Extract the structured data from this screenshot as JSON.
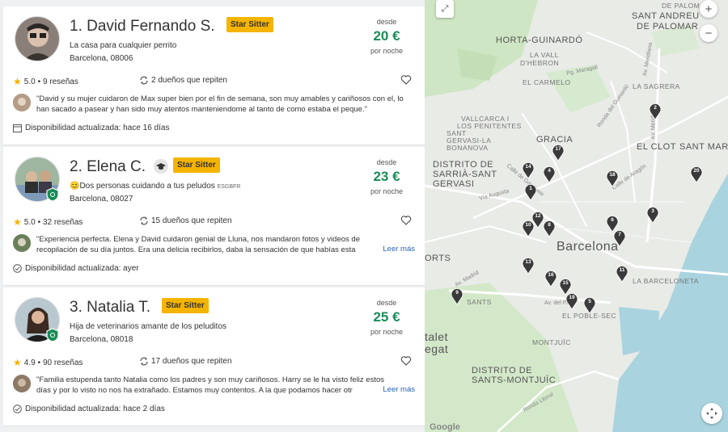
{
  "sitters": [
    {
      "name": "1. David Fernando S.",
      "badge": "Star Sitter",
      "tagline": "La casa para cualquier perrito",
      "address": "Barcelona, 08006",
      "desde": "desde",
      "price": "20 €",
      "per": "por noche",
      "rating": "5.0",
      "reviews": "• 9 reseñas",
      "repeat": "2 dueños que repiten",
      "review": "\"David y su mujer cuidaron de Max super bien por el fin de semana, son muy amables y cariñosos con el, lo han sacado a pasear y han sido muy atentos manteniendome al tanto de como estaba el peque.\"",
      "availability": "Disponibilidad actualizada: hace 16 días"
    },
    {
      "name": "2. Elena C.",
      "badge": "Star Sitter",
      "tagline": "Dos personas cuidando a tus peludos",
      "tagline_suffix": "ESGBFR",
      "address": "Barcelona, 08027",
      "desde": "desde",
      "price": "23 €",
      "per": "por noche",
      "rating": "5.0",
      "reviews": "• 32 reseñas",
      "repeat": "15 dueños que repiten",
      "review": "\"Experiencia perfecta. Elena y David cuidaron genial de Lluna, nos mandaron fotos y videos de recopilación de su día juntos. Era una delicia recibirlos, daba la sensación de que habías esta",
      "read_more": "Leer más",
      "availability": "Disponibilidad actualizada: ayer"
    },
    {
      "name": "3. Natalia T.",
      "badge": "Star Sitter",
      "tagline": "Hija de veterinarios amante de los peluditos",
      "address": "Barcelona, 08018",
      "desde": "desde",
      "price": "25 €",
      "per": "por noche",
      "rating": "4.9",
      "reviews": "• 90 reseñas",
      "repeat": "17 dueños que repiten",
      "review": "\"Familia estupenda tanto Natalia como los padres y son muy cariñosos. Harry se le ha visto feliz estos días y por lo visto no nos ha extrañado. Estamos muy contentos. A la que podamos hacer otr",
      "read_more": "Leer más",
      "availability": "Disponibilidad actualizada: hace 2 días"
    }
  ],
  "map": {
    "labels": {
      "horta": "HORTA-GUINARDÓ",
      "vall1": "LA VALL",
      "vall2": "D'HEBRON",
      "carmel": "EL CARMELO",
      "sagrera": "LA SAGRERA",
      "palomar1": "SANT ANDREU",
      "palomar2": "DE PALOMAR",
      "palomar0": "DE PALOMAR",
      "vallcarca1": "VALLCARCA I",
      "vallcarca2": "LOS PENITENTES",
      "gervasi1": "SANT",
      "gervasi2": "GERVASI-LA",
      "gervasi3": "BONANOVA",
      "gracia": "GRACIA",
      "sarria1": "DISTRITO DE",
      "sarria2": "SARRIÀ-SANT",
      "sarria3": "GERVASI",
      "clot": "EL CLOT",
      "santmar": "SANT MAR",
      "barcelona": "Barcelona",
      "orts": "ORTS",
      "barceloneta1": "LA BARCELONETA",
      "barceloneta0": "LA",
      "sants": "SANTS",
      "poblesec": "EL POBLE-SEC",
      "montjuic": "MONTJUÏC",
      "distrito1": "DISTRITO DE",
      "distrito2": "SANTS-MONTJUÏC",
      "talet": "talet",
      "egat": "egat",
      "pmaragall": "Pg. Maragall",
      "meridiana": "Av. Meridiana",
      "ronda": "Ronda del Guinardó",
      "aragon": "Calle de Aragón",
      "augusta": "Vía Augusta",
      "madrid": "Av. Madrid",
      "paral": "Av. del Pa",
      "litoral": "Ronda Litoral",
      "ganduxer": "Calle de Ganduxer",
      "meridiana2": "Av. Meridiana",
      "ronda2": "Ronda del Gu"
    },
    "pins": [
      "2",
      "17",
      "14",
      "4",
      "18",
      "20",
      "1",
      "12",
      "10",
      "8",
      "6",
      "3",
      "7",
      "13",
      "11",
      "16",
      "15",
      "19",
      "5",
      "9"
    ],
    "google": "Google",
    "zoom_in": "+",
    "zoom_out": "−"
  },
  "colors": {
    "price": "#1a8c57",
    "badge": "#f5b400",
    "link": "#2764b0",
    "pin": "#3a3a3a",
    "water": "#a9d3df",
    "park": "#cfe6c4"
  }
}
